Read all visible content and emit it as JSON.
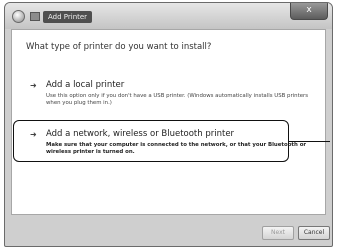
{
  "window": {
    "title": "Add Printer",
    "close_label": "x"
  },
  "wizard": {
    "question": "What type of printer do you want to install?",
    "options": [
      {
        "title": "Add a local printer",
        "description": "Use this option only if you don't have a USB printer. (Windows automatically installs USB printers when you plug them in.)",
        "icon": "local-printer-icon"
      },
      {
        "title": "Add a network, wireless or Bluetooth printer",
        "description": "Make sure that your computer is connected to the network, or that your Bluetooth or wireless printer is turned on.",
        "icon": "network-printer-icon"
      }
    ]
  },
  "footer": {
    "next_label": "Next",
    "cancel_label": "Cancel"
  }
}
